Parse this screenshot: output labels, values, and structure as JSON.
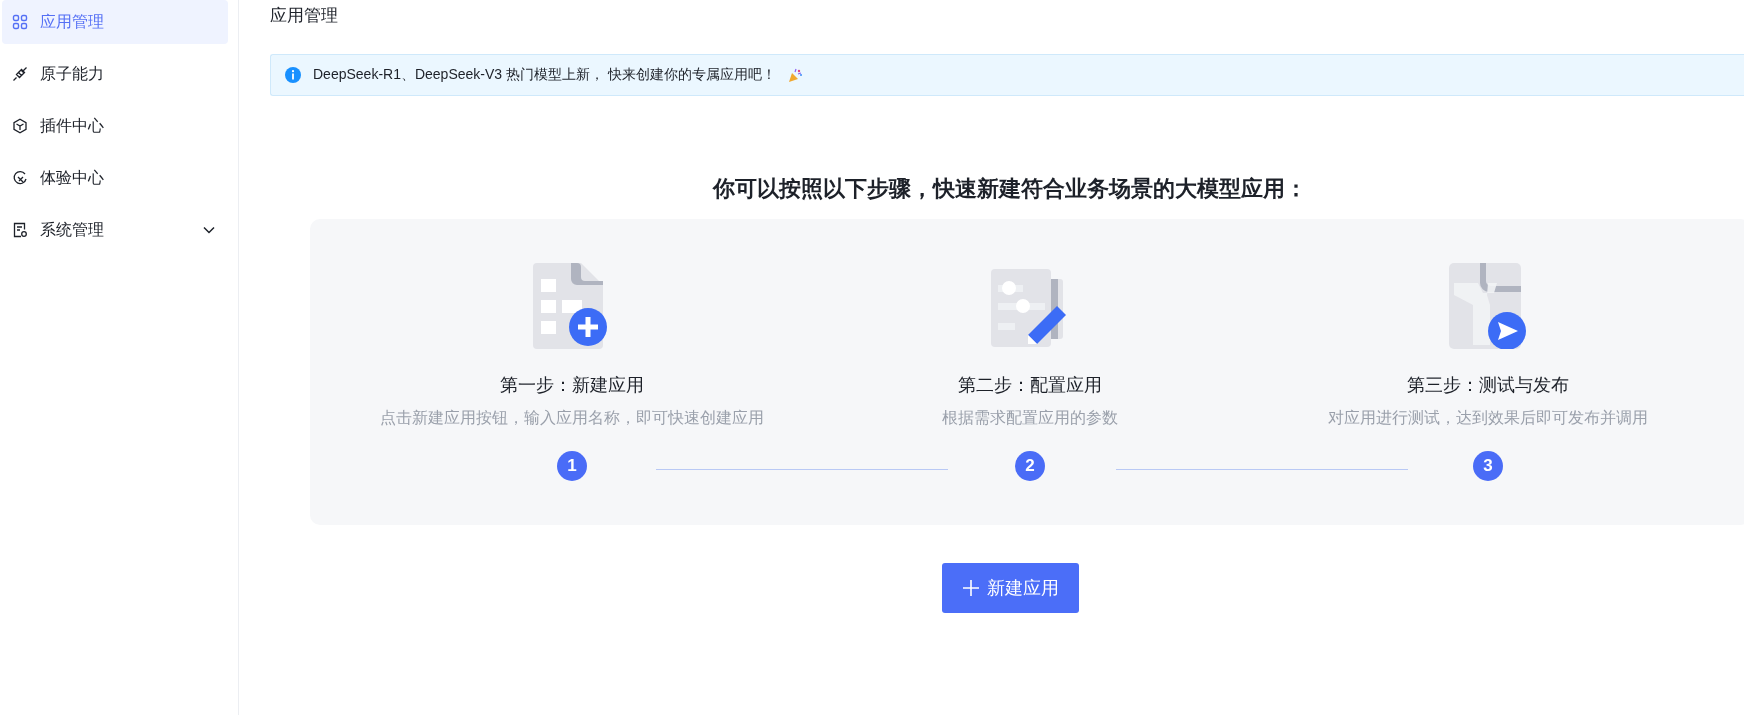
{
  "sidebar": {
    "items": [
      {
        "kind": "grid",
        "label": "应用管理",
        "selected": true
      },
      {
        "kind": "plug",
        "label": "原子能力",
        "selected": false
      },
      {
        "kind": "cube",
        "label": "插件中心",
        "selected": false
      },
      {
        "kind": "orbit",
        "label": "体验中心",
        "selected": false
      },
      {
        "kind": "settings",
        "label": "系统管理",
        "selected": false,
        "expanded": false
      }
    ]
  },
  "page_title": "应用管理",
  "notice": {
    "text": "DeepSeek-R1、DeepSeek-V3 热门模型上新， 快来创建你的专属应用吧！"
  },
  "guide": {
    "heading": "你可以按照以下步骤，快速新建符合业务场景的大模型应用：",
    "steps": [
      {
        "kind": "create",
        "title": "第一步：新建应用",
        "description": "点击新建应用按钮，输入应用名称，即可快速创建应用",
        "number": "1"
      },
      {
        "kind": "configure",
        "title": "第二步：配置应用",
        "description": "根据需求配置应用的参数",
        "number": "2"
      },
      {
        "kind": "publish",
        "title": "第三步：测试与发布",
        "description": "对应用进行测试，达到效果后即可发布并调用",
        "number": "3"
      }
    ]
  },
  "create_button": {
    "label": "新建应用"
  }
}
